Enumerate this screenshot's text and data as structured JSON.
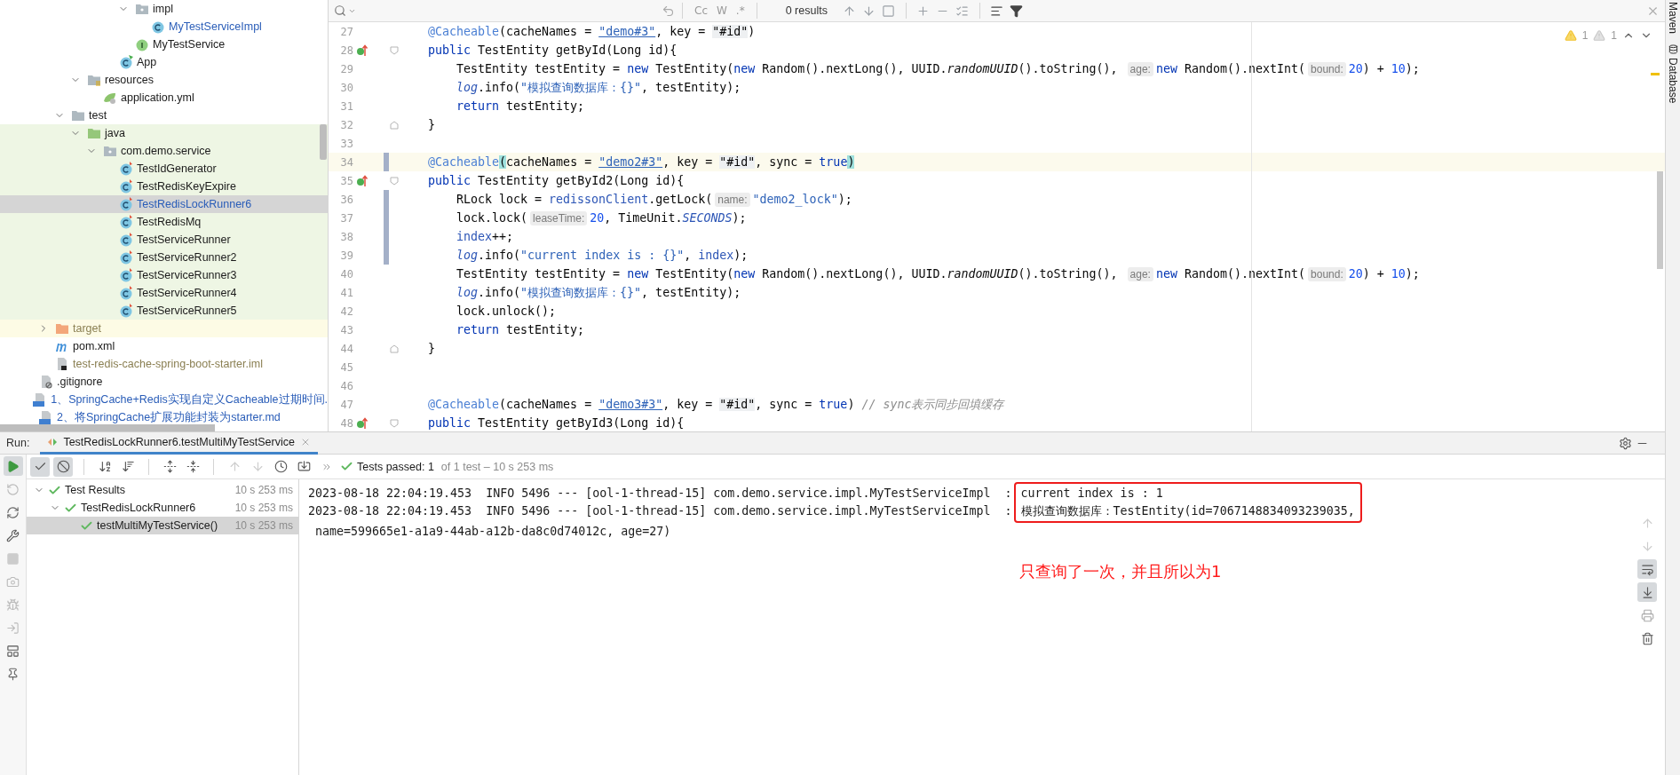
{
  "project_tree": {
    "items": [
      {
        "children": [
          {
            "children": [
              {
                "children": [
                  {
                    "children": [
                      {
                        "children": [
                          {
                            "children": [
                              {
                                "label": "impl",
                                "kind": "package",
                                "expanded": true,
                                "selected": false,
                                "children": [
                                  {
                                    "label": "MyTestServiceImpl",
                                    "kind": "class",
                                    "modified": true,
                                    "selected": false
                                  }
                                ]
                              },
                              {
                                "label": "MyTestService",
                                "kind": "interface",
                                "selected": false
                              }
                            ]
                          },
                          {
                            "label": "App",
                            "kind": "app-class",
                            "selected": false
                          }
                        ]
                      }
                    ]
                  },
                  {
                    "label": "resources",
                    "kind": "resources-folder",
                    "expanded": true,
                    "selected": false,
                    "children": [
                      {
                        "label": "application.yml",
                        "kind": "yml",
                        "selected": false
                      }
                    ]
                  }
                ]
              },
              {
                "label": "test",
                "kind": "folder",
                "expanded": true,
                "selected": false,
                "children": [
                  {
                    "label": "java",
                    "kind": "source-folder",
                    "expanded": true,
                    "test_scope": true,
                    "selected": false,
                    "children": [
                      {
                        "label": "com.demo.service",
                        "kind": "package",
                        "expanded": true,
                        "selected": false,
                        "children": [
                          {
                            "label": "TestIdGenerator",
                            "kind": "test-class",
                            "selected": false
                          },
                          {
                            "label": "TestRedisKeyExpire",
                            "kind": "test-class",
                            "selected": false
                          },
                          {
                            "label": "TestRedisLockRunner6",
                            "kind": "test-class",
                            "modified": true,
                            "selected": true
                          },
                          {
                            "label": "TestRedisMq",
                            "kind": "test-class",
                            "selected": false
                          },
                          {
                            "label": "TestServiceRunner",
                            "kind": "test-class",
                            "selected": false
                          },
                          {
                            "label": "TestServiceRunner2",
                            "kind": "test-class",
                            "selected": false
                          },
                          {
                            "label": "TestServiceRunner3",
                            "kind": "test-class",
                            "selected": false
                          },
                          {
                            "label": "TestServiceRunner4",
                            "kind": "test-class",
                            "selected": false
                          },
                          {
                            "label": "TestServiceRunner5",
                            "kind": "test-class",
                            "selected": false
                          }
                        ]
                      }
                    ]
                  }
                ]
              }
            ]
          },
          {
            "label": "target",
            "kind": "excluded-folder",
            "expanded": false,
            "excluded": true,
            "ignored": true,
            "selected": false
          },
          {
            "label": "pom.xml",
            "kind": "xml",
            "selected": false
          },
          {
            "label": "test-redis-cache-spring-boot-starter.iml",
            "kind": "iml",
            "ignored": true,
            "selected": false
          }
        ]
      },
      {
        "label": ".gitignore",
        "kind": "ignore-file",
        "selected": false
      },
      {
        "label": "1、SpringCache+Redis实现自定义Cacheable过期时间.",
        "kind": "md",
        "modified": true,
        "selected": false
      },
      {
        "label": "2、将SpringCache扩展功能封装为starter.md",
        "kind": "md",
        "modified": true,
        "selected": false
      }
    ]
  },
  "editor": {
    "find_bar": {
      "options": [
        "Cc",
        "W",
        ".*"
      ],
      "results": "0 results"
    },
    "inspections": [
      {
        "kind": "warning",
        "count": "1"
      },
      {
        "kind": "weak-warning",
        "count": "1"
      }
    ],
    "lines": [
      {
        "number": "27",
        "kind": "member",
        "tokens": [
          {
            "kind": "annotation",
            "text": "@Cacheable"
          },
          {
            "kind": "plain",
            "text": "(cacheNames = "
          },
          {
            "kind": "link-string",
            "text": "\"demo#3\""
          },
          {
            "kind": "plain",
            "text": ", key = "
          },
          {
            "kind": "spel",
            "text": "\"#id\""
          },
          {
            "kind": "plain",
            "text": ")"
          }
        ]
      },
      {
        "number": "28",
        "kind": "member",
        "overrides": true,
        "fold_start": true,
        "tokens": [
          {
            "kind": "keyword",
            "text": "public"
          },
          {
            "kind": "plain",
            "text": " TestEntity getById(Long id){"
          }
        ]
      },
      {
        "number": "29",
        "kind": "statement",
        "tokens": [
          {
            "kind": "plain",
            "text": "TestEntity testEntity = "
          },
          {
            "kind": "keyword",
            "text": "new"
          },
          {
            "kind": "plain",
            "text": " TestEntity("
          },
          {
            "kind": "keyword",
            "text": "new"
          },
          {
            "kind": "plain",
            "text": " Random().nextLong(), UUID."
          },
          {
            "kind": "static-call",
            "text": "randomUUID"
          },
          {
            "kind": "plain",
            "text": "().toString(), "
          },
          {
            "kind": "hint",
            "text": "age:"
          },
          {
            "kind": "keyword",
            "text": "new"
          },
          {
            "kind": "plain",
            "text": " Random().nextInt("
          },
          {
            "kind": "hint",
            "text": "bound:"
          },
          {
            "kind": "number",
            "text": "20"
          },
          {
            "kind": "plain",
            "text": ") + "
          },
          {
            "kind": "number",
            "text": "10"
          },
          {
            "kind": "plain",
            "text": ");"
          }
        ]
      },
      {
        "number": "30",
        "kind": "statement",
        "tokens": [
          {
            "kind": "static-field",
            "text": "log"
          },
          {
            "kind": "plain",
            "text": ".info("
          },
          {
            "kind": "string",
            "text": "\"模拟查询数据库：{}\""
          },
          {
            "kind": "plain",
            "text": ", testEntity);"
          }
        ]
      },
      {
        "number": "31",
        "kind": "statement",
        "tokens": [
          {
            "kind": "keyword",
            "text": "return"
          },
          {
            "kind": "plain",
            "text": " testEntity;"
          }
        ]
      },
      {
        "number": "32",
        "kind": "member",
        "fold_end": true,
        "tokens": [
          {
            "kind": "plain",
            "text": "}"
          }
        ]
      },
      {
        "number": "33"
      },
      {
        "number": "34",
        "kind": "member",
        "current": true,
        "changed": true,
        "tokens": [
          {
            "kind": "annotation",
            "text": "@Cacheable"
          },
          {
            "kind": "brace",
            "text": "("
          },
          {
            "kind": "plain",
            "text": "cacheNames = "
          },
          {
            "kind": "link-string",
            "text": "\"demo2#3\""
          },
          {
            "kind": "plain",
            "text": ", key = "
          },
          {
            "kind": "spel",
            "text": "\"#id\""
          },
          {
            "kind": "plain",
            "text": ", sync = "
          },
          {
            "kind": "keyword",
            "text": "true"
          },
          {
            "kind": "brace",
            "text": ")"
          }
        ]
      },
      {
        "number": "35",
        "kind": "member",
        "overrides": true,
        "fold_start": true,
        "tokens": [
          {
            "kind": "keyword",
            "text": "public"
          },
          {
            "kind": "plain",
            "text": " TestEntity getById2(Long id){"
          }
        ]
      },
      {
        "number": "36",
        "kind": "statement",
        "changed": true,
        "tokens": [
          {
            "kind": "plain",
            "text": "RLock lock = "
          },
          {
            "kind": "field",
            "text": "redissonClient"
          },
          {
            "kind": "plain",
            "text": ".getLock("
          },
          {
            "kind": "hint",
            "text": "name:"
          },
          {
            "kind": "string",
            "text": "\"demo2_lock\""
          },
          {
            "kind": "plain",
            "text": ");"
          }
        ]
      },
      {
        "number": "37",
        "kind": "statement",
        "changed": true,
        "tokens": [
          {
            "kind": "plain",
            "text": "lock.lock("
          },
          {
            "kind": "hint",
            "text": "leaseTime:"
          },
          {
            "kind": "number",
            "text": "20"
          },
          {
            "kind": "plain",
            "text": ", TimeUnit."
          },
          {
            "kind": "constant",
            "text": "SECONDS"
          },
          {
            "kind": "plain",
            "text": ");"
          }
        ]
      },
      {
        "number": "38",
        "kind": "statement",
        "changed": true,
        "tokens": [
          {
            "kind": "field",
            "text": "index"
          },
          {
            "kind": "plain",
            "text": "++;"
          }
        ]
      },
      {
        "number": "39",
        "kind": "statement",
        "changed": true,
        "tokens": [
          {
            "kind": "static-field",
            "text": "log"
          },
          {
            "kind": "plain",
            "text": ".info("
          },
          {
            "kind": "string",
            "text": "\"current index is : {}\""
          },
          {
            "kind": "plain",
            "text": ", "
          },
          {
            "kind": "field",
            "text": "index"
          },
          {
            "kind": "plain",
            "text": ");"
          }
        ]
      },
      {
        "number": "40",
        "kind": "statement",
        "tokens": [
          {
            "kind": "plain",
            "text": "TestEntity testEntity = "
          },
          {
            "kind": "keyword",
            "text": "new"
          },
          {
            "kind": "plain",
            "text": " TestEntity("
          },
          {
            "kind": "keyword",
            "text": "new"
          },
          {
            "kind": "plain",
            "text": " Random().nextLong(), UUID."
          },
          {
            "kind": "static-call",
            "text": "randomUUID"
          },
          {
            "kind": "plain",
            "text": "().toString(), "
          },
          {
            "kind": "hint",
            "text": "age:"
          },
          {
            "kind": "keyword",
            "text": "new"
          },
          {
            "kind": "plain",
            "text": " Random().nextInt("
          },
          {
            "kind": "hint",
            "text": "bound:"
          },
          {
            "kind": "number",
            "text": "20"
          },
          {
            "kind": "plain",
            "text": ") + "
          },
          {
            "kind": "number",
            "text": "10"
          },
          {
            "kind": "plain",
            "text": ");"
          }
        ]
      },
      {
        "number": "41",
        "kind": "statement",
        "tokens": [
          {
            "kind": "static-field",
            "text": "log"
          },
          {
            "kind": "plain",
            "text": ".info("
          },
          {
            "kind": "string",
            "text": "\"模拟查询数据库：{}\""
          },
          {
            "kind": "plain",
            "text": ", testEntity);"
          }
        ]
      },
      {
        "number": "42",
        "kind": "statement",
        "tokens": [
          {
            "kind": "plain",
            "text": "lock.unlock();"
          }
        ]
      },
      {
        "number": "43",
        "kind": "statement",
        "tokens": [
          {
            "kind": "keyword",
            "text": "return"
          },
          {
            "kind": "plain",
            "text": " testEntity;"
          }
        ]
      },
      {
        "number": "44",
        "kind": "member",
        "fold_end": true,
        "tokens": [
          {
            "kind": "plain",
            "text": "}"
          }
        ]
      },
      {
        "number": "45"
      },
      {
        "number": "46"
      },
      {
        "number": "47",
        "kind": "member",
        "tokens": [
          {
            "kind": "annotation",
            "text": "@Cacheable"
          },
          {
            "kind": "plain",
            "text": "(cacheNames = "
          },
          {
            "kind": "link-string",
            "text": "\"demo3#3\""
          },
          {
            "kind": "plain",
            "text": ", key = "
          },
          {
            "kind": "spel",
            "text": "\"#id\""
          },
          {
            "kind": "plain",
            "text": ", sync = "
          },
          {
            "kind": "keyword",
            "text": "true"
          },
          {
            "kind": "plain",
            "text": ") "
          },
          {
            "kind": "comment",
            "text": "// sync表示同步回填缓存"
          }
        ]
      },
      {
        "number": "48",
        "kind": "member",
        "overrides": true,
        "fold_start": true,
        "tokens": [
          {
            "kind": "keyword",
            "text": "public"
          },
          {
            "kind": "plain",
            "text": " TestEntity getById3(Long id){"
          }
        ]
      }
    ]
  },
  "tool_strip": [
    {
      "label": "Maven",
      "kind": "maven"
    },
    {
      "label": "Database",
      "kind": "database"
    }
  ],
  "run": {
    "label": "Run:",
    "tab": {
      "title": "TestRedisLockRunner6.testMultiMyTestService"
    },
    "toolbar": {
      "show_passed": true,
      "show_ignored": true
    },
    "status": {
      "passed": "Tests passed: 1",
      "detail": "of 1 test – 10 s 253 ms"
    },
    "results": [
      {
        "label": "Test Results",
        "time": "10 s 253 ms",
        "passed": true,
        "expanded": true,
        "selected": false,
        "children": [
          {
            "label": "TestRedisLockRunner6",
            "time": "10 s 253 ms",
            "passed": true,
            "expanded": true,
            "selected": false,
            "children": [
              {
                "label": "testMultiMyTestService()",
                "time": "10 s 253 ms",
                "passed": true,
                "selected": true
              }
            ]
          }
        ]
      }
    ],
    "console": {
      "lines": [
        {
          "prefix": "2023-08-18 22:04:19.453  INFO 5496 --- [ool-1-thread-15] com.demo.service.impl.MyTestServiceImpl  :",
          "message": "current index is : 1"
        },
        {
          "prefix": "2023-08-18 22:04:19.453  INFO 5496 --- [ool-1-thread-15] com.demo.service.impl.MyTestServiceImpl  :",
          "message": "模拟查询数据库：TestEntity(id=7067148834093239035,"
        }
      ],
      "continuation": "name=599665e1-a1a9-44ab-a12b-da8c0d74012c, age=27)",
      "note": "只查询了一次，并且所以为1",
      "soft_wrap": true,
      "scroll_to_end": true
    }
  }
}
